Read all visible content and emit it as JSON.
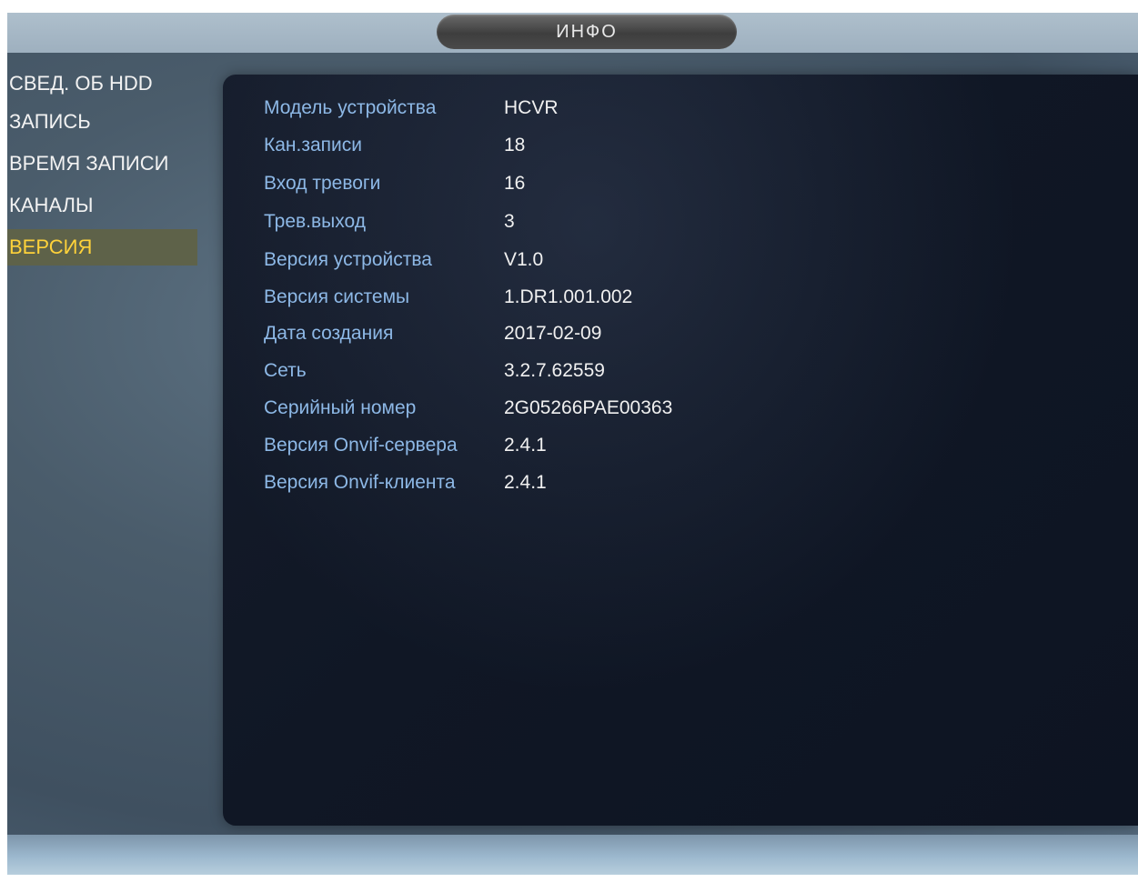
{
  "window": {
    "title": "ИНФО"
  },
  "sidebar": {
    "items": [
      {
        "label": "СВЕД. ОБ HDD",
        "active": false
      },
      {
        "label": "ЗАПИСЬ",
        "active": false
      },
      {
        "label": "ВРЕМЯ ЗАПИСИ",
        "active": false
      },
      {
        "label": "КАНАЛЫ",
        "active": false
      },
      {
        "label": "ВЕРСИЯ",
        "active": true
      }
    ]
  },
  "version_info": {
    "rows": [
      {
        "label": "Модель устройства",
        "value": "HCVR"
      },
      {
        "label": "Кан.записи",
        "value": "18"
      },
      {
        "label": "Вход тревоги",
        "value": "16"
      },
      {
        "label": "Трев.выход",
        "value": "3"
      },
      {
        "label": "Версия устройства",
        "value": "V1.0"
      },
      {
        "label": "Версия системы",
        "value": "1.DR1.001.002"
      },
      {
        "label": "Дата создания",
        "value": "2017-02-09"
      },
      {
        "label": "Сеть",
        "value": "3.2.7.62559"
      },
      {
        "label": "Серийный номер",
        "value": "2G05266PAE00363"
      },
      {
        "label": "Версия Onvif-сервера",
        "value": "2.4.1"
      },
      {
        "label": "Версия Onvif-клиента",
        "value": "2.4.1"
      }
    ]
  },
  "colors": {
    "label": "#8db8e6",
    "value": "#f0f0f0",
    "active_menu_text": "#ffd23a",
    "active_menu_bg": "#5e6249",
    "panel_bg": "#121a28"
  }
}
